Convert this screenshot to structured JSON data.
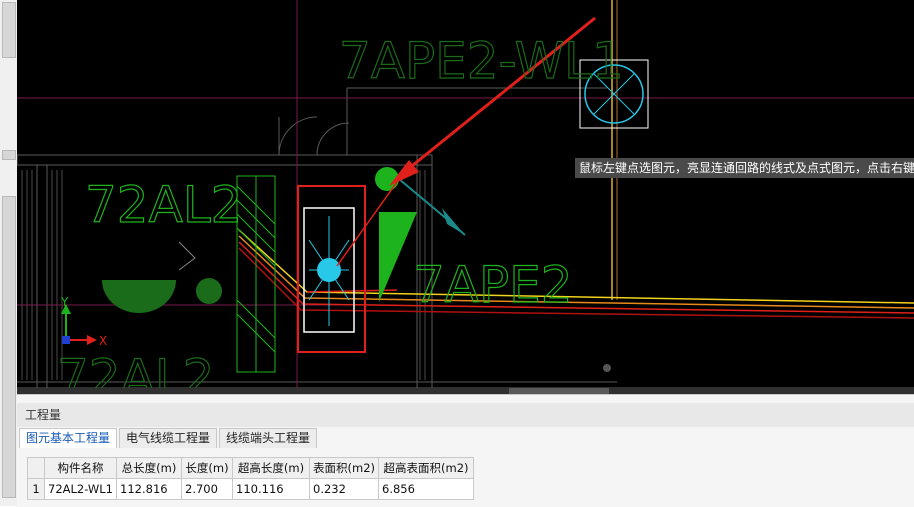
{
  "cad": {
    "labels": {
      "top_circuit": "7APE2-WL1",
      "left_box": "72AL2",
      "right_box": "7APE2",
      "bottom_box": "72AL2"
    },
    "axis": {
      "x": "X",
      "y": "Y"
    },
    "tooltip": "鼠标左键点选图元，亮显连通回路的线式及点式图元，点击右键"
  },
  "panel": {
    "title": "工程量",
    "tabs": [
      {
        "label": "图元基本工程量",
        "active": true
      },
      {
        "label": "电气线缆工程量",
        "active": false
      },
      {
        "label": "线缆端头工程量",
        "active": false
      }
    ],
    "table": {
      "headers": [
        "构件名称",
        "总长度(m)",
        "长度(m)",
        "超高长度(m)",
        "表面积(m2)",
        "超高表面积(m2)"
      ],
      "rows": [
        {
          "num": "1",
          "cells": [
            "72AL2-WL1",
            "112.816",
            "2.700",
            "110.116",
            "0.232",
            "6.856"
          ]
        }
      ]
    }
  },
  "colors": {
    "cad_bg": "#000000",
    "label_green": "#1db31d",
    "highlight_red": "#e0201a",
    "cable_yellow": "#f2d21a",
    "symbol_cyan": "#28c8e8"
  }
}
